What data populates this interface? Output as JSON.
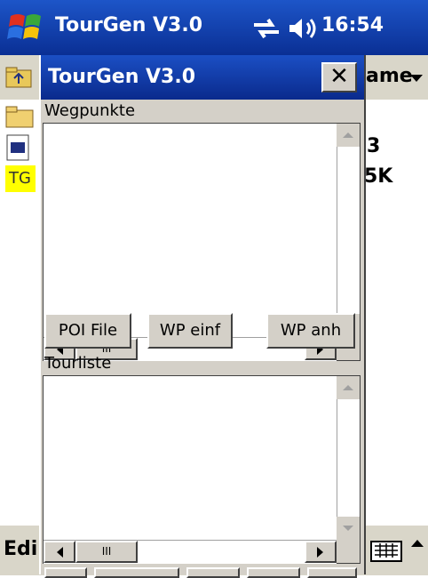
{
  "taskbar": {
    "title": "TourGen V3.0",
    "clock": "16:54"
  },
  "explorer": {
    "sort_label": "ame",
    "file_text_1": "3",
    "file_text_2": "5K",
    "file_tg": "TG"
  },
  "menubar": {
    "edit": "Edi"
  },
  "dialog": {
    "title": "TourGen V3.0",
    "close_label": "✕",
    "waypoints_label": "Wegpunkte",
    "buttons": {
      "poi_file": "POI File",
      "wp_insert": "WP einf",
      "wp_append": "WP anh"
    },
    "tourlist_label": "Tourliste",
    "scroll_thumb_grip": "III"
  },
  "icons": [
    "windows-start-icon",
    "connectivity-icon",
    "volume-icon",
    "folder-up-icon",
    "keyboard-icon"
  ],
  "colors": {
    "titlebar": "#0a2f94",
    "dialog_face": "#d4d0c8",
    "highlight": "#ffff00"
  }
}
